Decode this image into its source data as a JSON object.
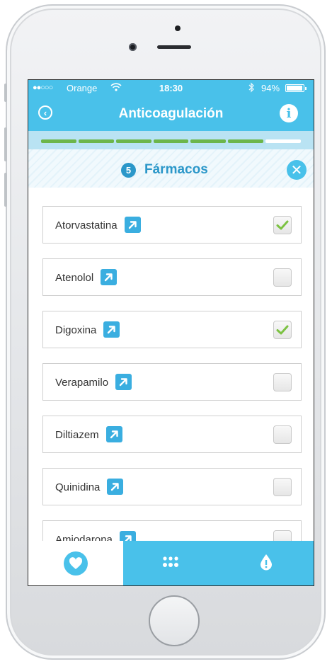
{
  "status_bar": {
    "signal": "●●○○○",
    "carrier": "Orange",
    "wifi_icon": "wifi-icon",
    "time": "18:30",
    "bluetooth_icon": "bluetooth-icon",
    "battery_percent": "94%",
    "battery_level": 0.94
  },
  "nav": {
    "title": "Anticoagulación",
    "back_icon": "back-circle-icon",
    "info_icon": "info-icon"
  },
  "progress": {
    "total_steps": 7,
    "completed_steps": 6,
    "done_color": "#6cb64a"
  },
  "section": {
    "step_number": "5",
    "title": "Fármacos",
    "close_icon": "close-icon"
  },
  "drugs": [
    {
      "name": "Atorvastatina",
      "checked": true
    },
    {
      "name": "Atenolol",
      "checked": false
    },
    {
      "name": "Digoxina",
      "checked": true
    },
    {
      "name": "Verapamilo",
      "checked": false
    },
    {
      "name": "Diltiazem",
      "checked": false
    },
    {
      "name": "Quinidina",
      "checked": false
    },
    {
      "name": "Amiodarona",
      "checked": false
    }
  ],
  "tabs": [
    {
      "icon": "heart-drop-icon",
      "active": true
    },
    {
      "icon": "dots-grid-icon",
      "active": false
    },
    {
      "icon": "alert-drop-icon",
      "active": false
    }
  ],
  "colors": {
    "accent": "#49c1ea",
    "header_text": "#2b97c9",
    "link_button": "#3aaee0",
    "check": "#7cc242"
  }
}
